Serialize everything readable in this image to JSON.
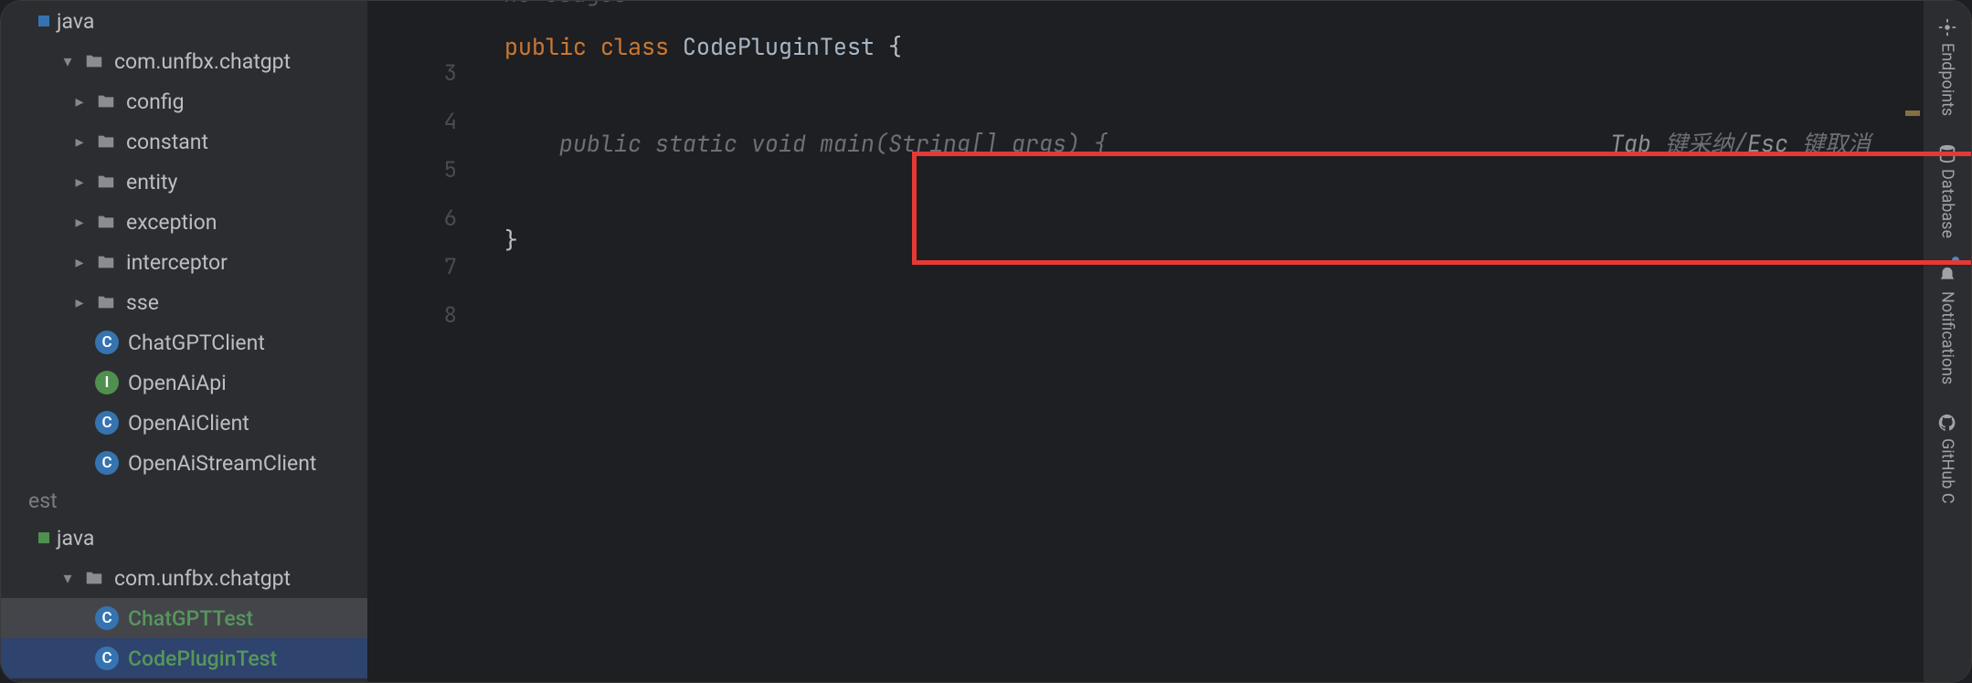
{
  "sidebar": {
    "top_root": "java",
    "package": "com.unfbx.chatgpt",
    "folders": [
      "config",
      "constant",
      "entity",
      "exception",
      "interceptor",
      "sse"
    ],
    "classes": [
      {
        "name": "ChatGPTClient",
        "icon": "C",
        "color": "c"
      },
      {
        "name": "OpenAiApi",
        "icon": "I",
        "color": "i"
      },
      {
        "name": "OpenAiClient",
        "icon": "C",
        "color": "c"
      },
      {
        "name": "OpenAiStreamClient",
        "icon": "C",
        "color": "c"
      }
    ],
    "test_section": "est",
    "test_root": "java",
    "test_package": "com.unfbx.chatgpt",
    "test_classes": [
      {
        "name": "ChatGPTTest",
        "icon": "C",
        "selected": "secondary"
      },
      {
        "name": "CodePluginTest",
        "icon": "C",
        "selected": "primary"
      }
    ]
  },
  "editor": {
    "usages_hint": "no usages",
    "gutter": [
      "3",
      "4",
      "5",
      "6",
      "7",
      "8"
    ],
    "line3": {
      "kw1": "public ",
      "kw2": "class ",
      "name": "CodePluginTest ",
      "brace": "{"
    },
    "line5_suggestion": "    public static void main(String[] args) {",
    "line5_hint_tab": "Tab",
    "line5_hint_accept": " 键采纳/",
    "line5_hint_esc": "Esc",
    "line5_hint_cancel": " 键取消",
    "line7_close": "}"
  },
  "right_tools": {
    "endpoints": "Endpoints",
    "database": "Database",
    "notifications": "Notifications",
    "github": "GitHub C"
  }
}
